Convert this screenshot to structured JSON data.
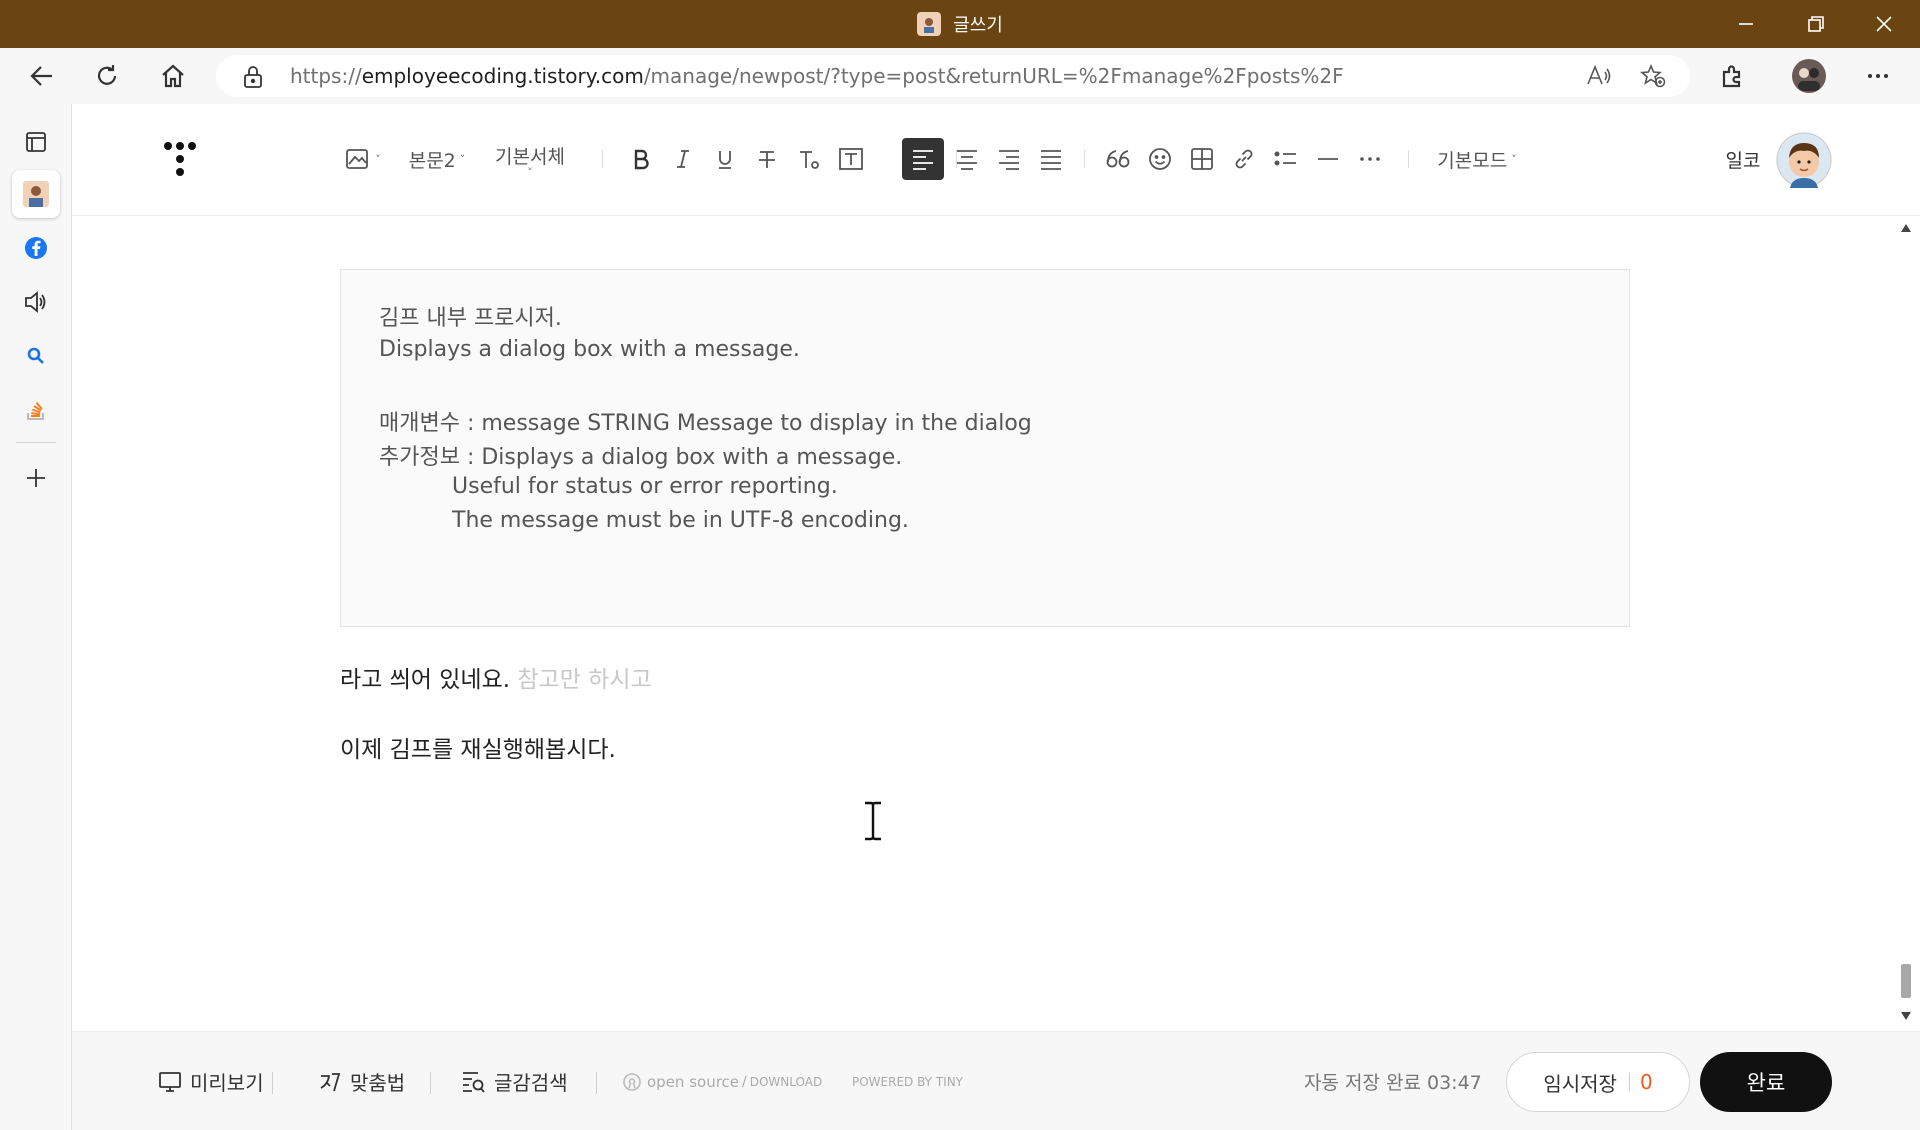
{
  "window": {
    "title": "글쓰기",
    "colors": {
      "titlebar": "#6b4511"
    }
  },
  "browser": {
    "url_prefix": "https://",
    "url_host": "employeecoding.tistory.com",
    "url_path": "/manage/newpost/?type=post&returnURL=%2Fmanage%2Fposts%2F"
  },
  "toolbar": {
    "paragraph_style": "본문2",
    "font_family": "기본서체",
    "mode": "기본모드",
    "user_name": "일코"
  },
  "content": {
    "quote_lines": [
      "김프 내부 프로시저.",
      "Displays a dialog box with a message.",
      "매개변수 : message STRING Message to display in the dialog",
      "추가정보 : Displays a dialog box with a message.",
      "Useful for status or error reporting.",
      "The message must be in UTF-8 encoding."
    ],
    "para1_main": "라고 씌어 있네요. ",
    "para1_placeholder": "참고만 하시고",
    "para2": "이제 김프를 재실행해봅시다."
  },
  "bottom": {
    "preview": "미리보기",
    "spellcheck": "맞춤법",
    "search": "글감검색",
    "opensource": "open source",
    "download": "DOWNLOAD",
    "powered": "POWERED BY TINY",
    "autosave": "자동 저장 완료 03:47",
    "temp_save": "임시저장",
    "temp_count": "0",
    "done": "완료"
  }
}
